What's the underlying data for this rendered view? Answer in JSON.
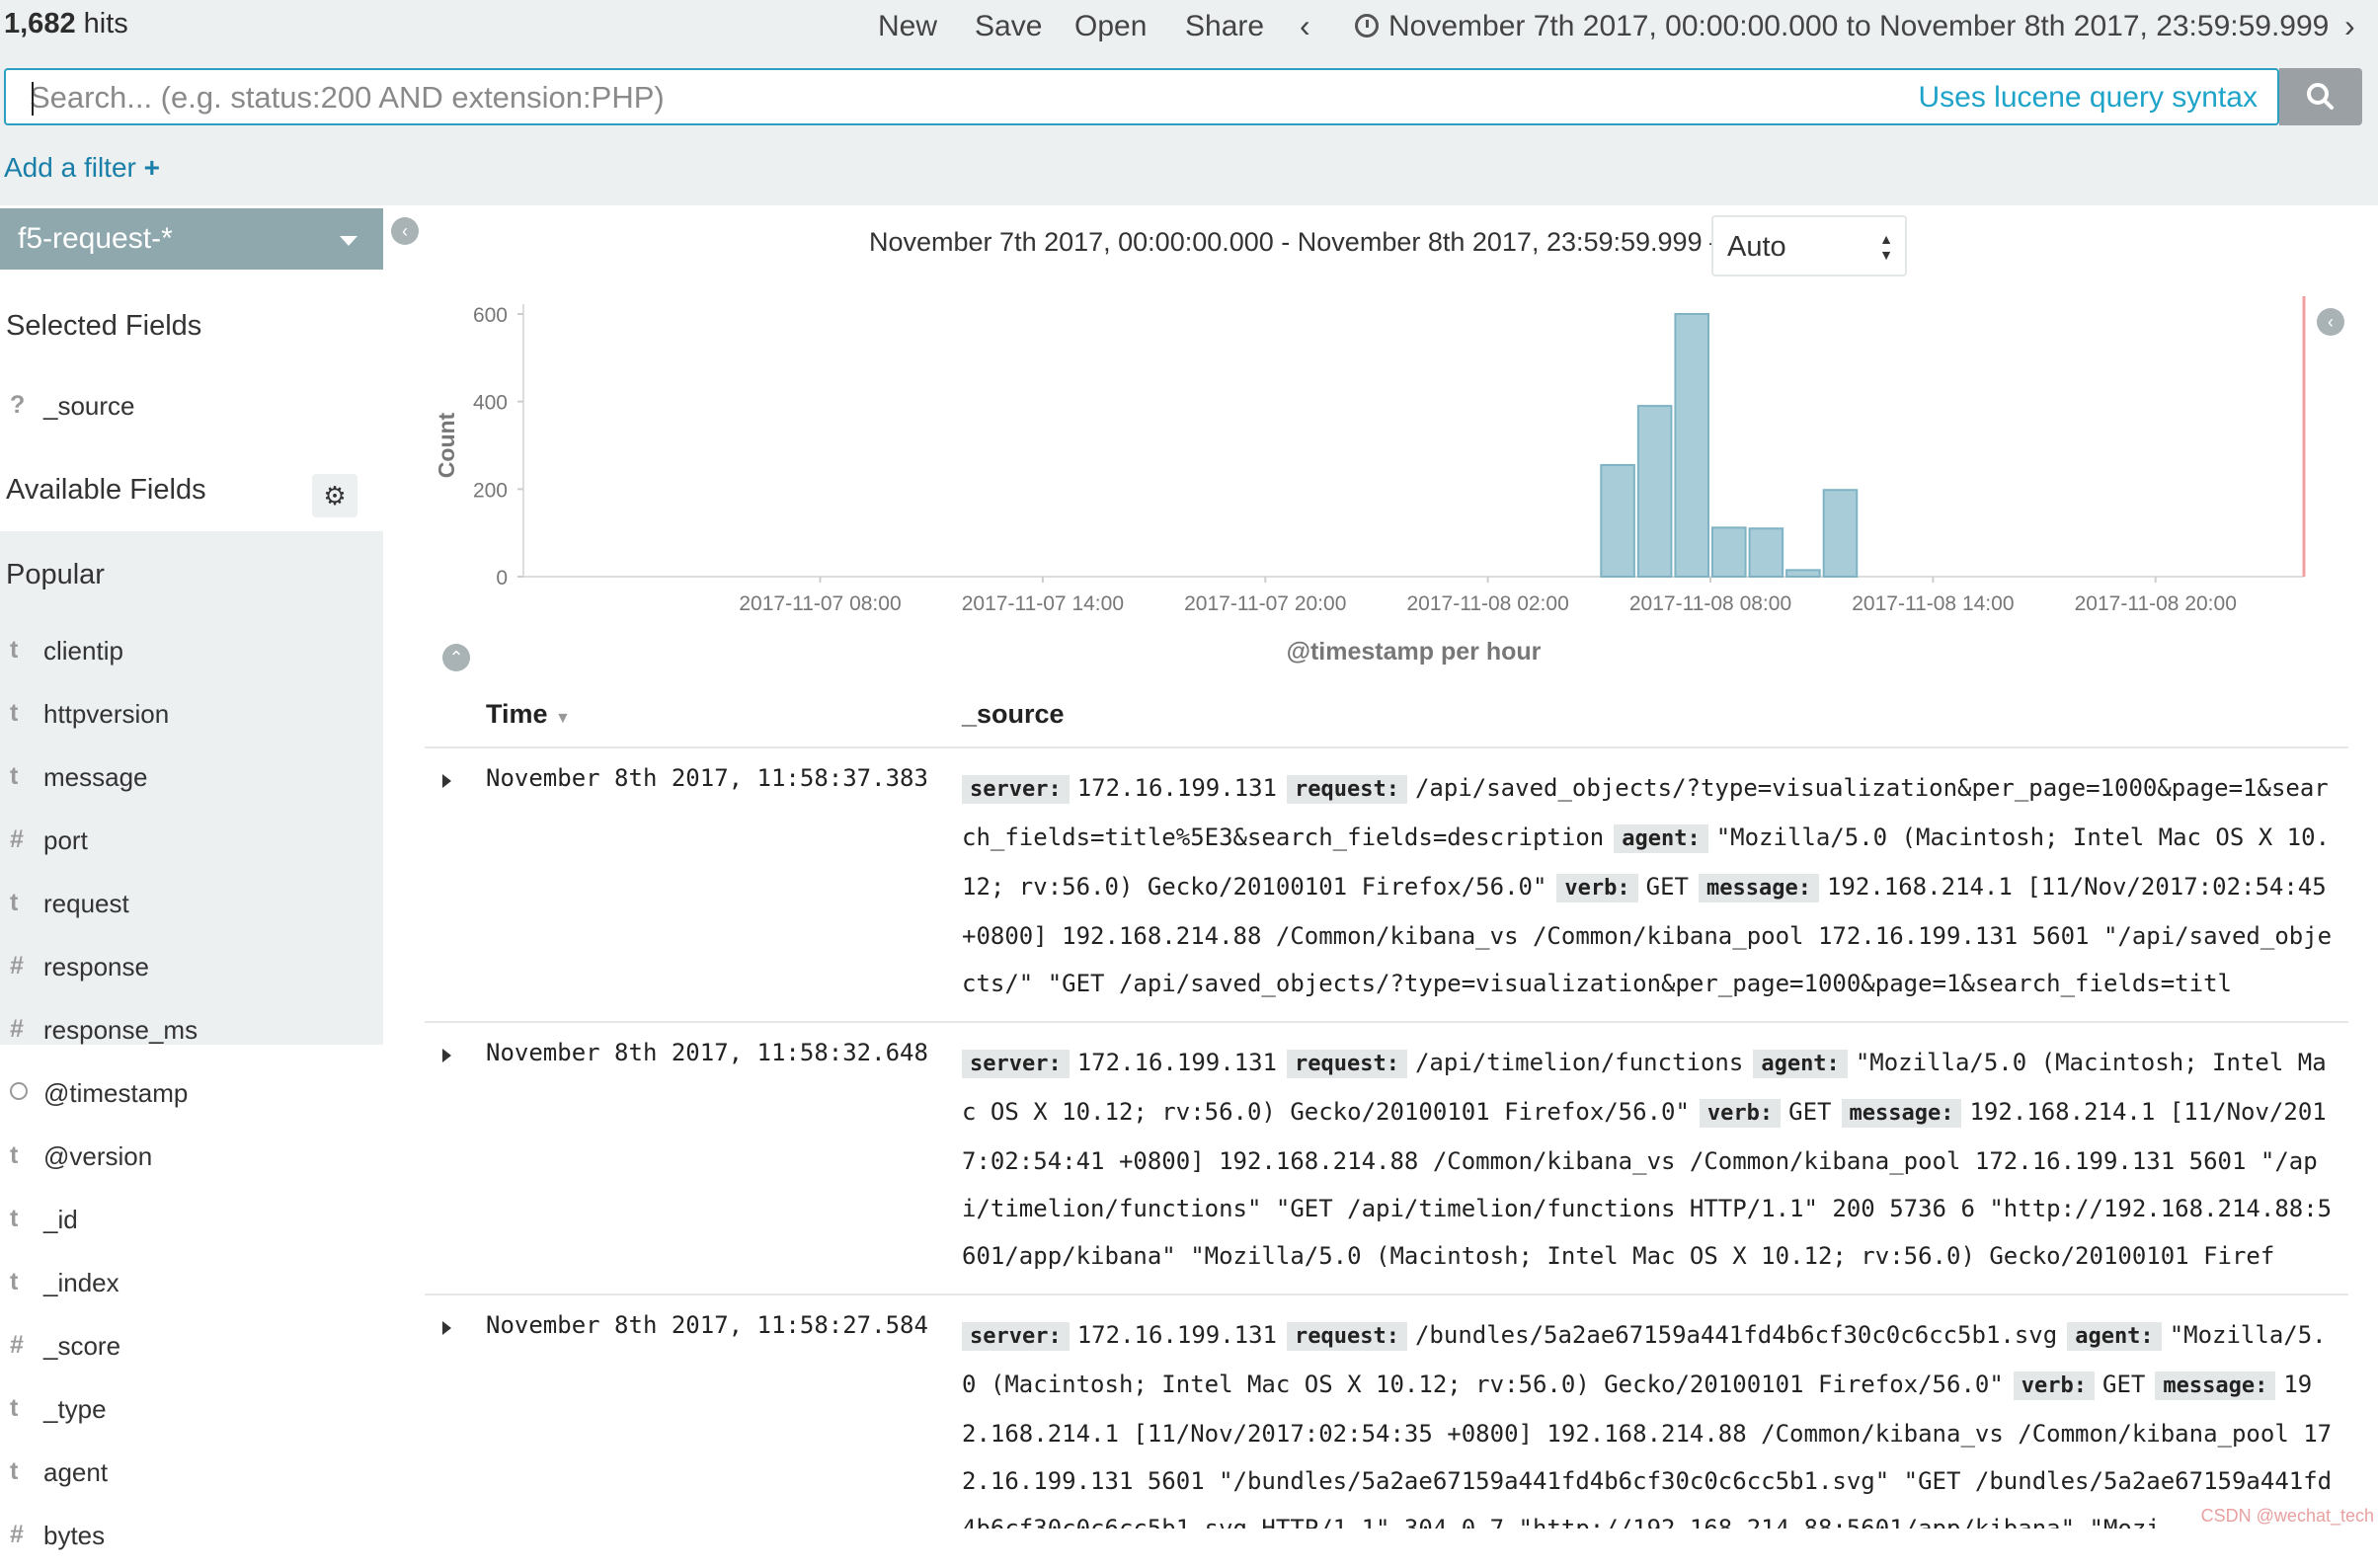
{
  "header": {
    "hits_count": "1,682",
    "hits_label": "hits",
    "nav": [
      "New",
      "Save",
      "Open",
      "Share"
    ],
    "time_range": "November 7th 2017, 00:00:00.000 to November 8th 2017, 23:59:59.999"
  },
  "search": {
    "placeholder": "Search... (e.g. status:200 AND extension:PHP)",
    "hint": "Uses lucene query syntax"
  },
  "filter": {
    "add_label": "Add a filter",
    "plus": "+"
  },
  "sidebar": {
    "index_pattern": "f5-request-*",
    "selected_title": "Selected Fields",
    "selected_fields": [
      {
        "type": "?",
        "name": "_source"
      }
    ],
    "available_title": "Available Fields",
    "popular_title": "Popular",
    "popular_fields": [
      {
        "type": "t",
        "name": "clientip"
      },
      {
        "type": "t",
        "name": "httpversion"
      },
      {
        "type": "t",
        "name": "message"
      },
      {
        "type": "#",
        "name": "port"
      },
      {
        "type": "t",
        "name": "request"
      },
      {
        "type": "#",
        "name": "response"
      },
      {
        "type": "#",
        "name": "response_ms"
      }
    ],
    "other_fields": [
      {
        "type": "clock",
        "name": "@timestamp"
      },
      {
        "type": "t",
        "name": "@version"
      },
      {
        "type": "t",
        "name": "_id"
      },
      {
        "type": "t",
        "name": "_index"
      },
      {
        "type": "#",
        "name": "_score"
      },
      {
        "type": "t",
        "name": "_type"
      },
      {
        "type": "t",
        "name": "agent"
      },
      {
        "type": "#",
        "name": "bytes"
      }
    ]
  },
  "histogram": {
    "date_range": "November 7th 2017, 00:00:00.000 - November 8th 2017, 23:59:59.999 —",
    "interval": "Auto"
  },
  "chart_data": {
    "type": "bar",
    "xlabel": "@timestamp per hour",
    "ylabel": "Count",
    "ylim": [
      0,
      600
    ],
    "yticks": [
      0,
      200,
      400,
      600
    ],
    "xticks": [
      "2017-11-07 08:00",
      "2017-11-07 14:00",
      "2017-11-07 20:00",
      "2017-11-08 02:00",
      "2017-11-08 08:00",
      "2017-11-08 14:00",
      "2017-11-08 20:00"
    ],
    "x_range_hours": [
      0,
      48
    ],
    "bar_width_hours": 1,
    "bars": [
      {
        "hour": 29,
        "value": 255
      },
      {
        "hour": 30,
        "value": 390
      },
      {
        "hour": 31,
        "value": 600
      },
      {
        "hour": 32,
        "value": 112
      },
      {
        "hour": 33,
        "value": 110
      },
      {
        "hour": 34,
        "value": 15
      },
      {
        "hour": 35,
        "value": 198
      }
    ],
    "color": "#a8cdd9"
  },
  "table": {
    "col_time": "Time",
    "col_source": "_source",
    "rows": [
      {
        "time": "November 8th 2017, 11:58:37.383",
        "fields": [
          {
            "k": "server:",
            "v": "172.16.199.131"
          },
          {
            "k": "request:",
            "v": "/api/saved_objects/?type=visualization&per_page=1000&page=1&search_fields=title%5E3&search_fields=description"
          },
          {
            "k": "agent:",
            "v": "\"Mozilla/5.0 (Macintosh; Intel Mac OS X 10.12; rv:56.0) Gecko/20100101 Firefox/56.0\""
          },
          {
            "k": "verb:",
            "v": "GET"
          },
          {
            "k": "message:",
            "v": "192.168.214.1 [11/Nov/2017:02:54:45 +0800] 192.168.214.88 /Common/kibana_vs /Common/kibana_pool 172.16.199.131 5601 \"/api/saved_objects/\" \"GET /api/saved_objects/?type=visualization&per_page=1000&page=1&search_fields=titl"
          }
        ]
      },
      {
        "time": "November 8th 2017, 11:58:32.648",
        "fields": [
          {
            "k": "server:",
            "v": "172.16.199.131"
          },
          {
            "k": "request:",
            "v": "/api/timelion/functions"
          },
          {
            "k": "agent:",
            "v": "\"Mozilla/5.0 (Macintosh; Intel Mac OS X 10.12; rv:56.0) Gecko/20100101 Firefox/56.0\""
          },
          {
            "k": "verb:",
            "v": "GET"
          },
          {
            "k": "message:",
            "v": "192.168.214.1 [11/Nov/2017:02:54:41 +0800] 192.168.214.88 /Common/kibana_vs /Common/kibana_pool 172.16.199.131 5601 \"/api/timelion/functions\" \"GET /api/timelion/functions HTTP/1.1\" 200 5736 6 \"http://192.168.214.88:5601/app/kibana\" \"Mozilla/5.0 (Macintosh; Intel Mac OS X 10.12; rv:56.0) Gecko/20100101 Firef"
          }
        ]
      },
      {
        "time": "November 8th 2017, 11:58:27.584",
        "fields": [
          {
            "k": "server:",
            "v": "172.16.199.131"
          },
          {
            "k": "request:",
            "v": "/bundles/5a2ae67159a441fd4b6cf30c0c6cc5b1.svg"
          },
          {
            "k": "agent:",
            "v": "\"Mozilla/5.0 (Macintosh; Intel Mac OS X 10.12; rv:56.0) Gecko/20100101 Firefox/56.0\""
          },
          {
            "k": "verb:",
            "v": "GET"
          },
          {
            "k": "message:",
            "v": "192.168.214.1 [11/Nov/2017:02:54:35 +0800] 192.168.214.88 /Common/kibana_vs /Common/kibana_pool 172.16.199.131 5601 \"/bundles/5a2ae67159a441fd4b6cf30c0c6cc5b1.svg\" \"GET /bundles/5a2ae67159a441fd4b6cf30c0c6cc5b1.svg HTTP/1.1\" 304 0 7 \"http://192.168.214.88:5601/app/kibana\" \"Mozi"
          }
        ]
      }
    ]
  },
  "watermark": "CSDN @wechat_tech"
}
